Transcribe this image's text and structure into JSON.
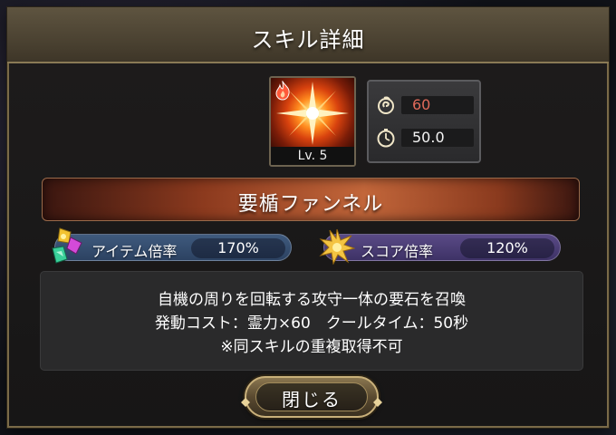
{
  "dialog": {
    "title": "スキル詳細"
  },
  "skill": {
    "level": "Lv. 5",
    "element_icon": "fire-icon",
    "name": "要楯ファンネル"
  },
  "stats": {
    "cost_icon": "spirit-swirl-icon",
    "cost": "60",
    "cost_color": "#e06a5a",
    "cooldown_icon": "stopwatch-icon",
    "cooldown": "50.0"
  },
  "multipliers": {
    "item": {
      "icon": "gems-icon",
      "label": "アイテム倍率",
      "value": "170%"
    },
    "score": {
      "icon": "star-burst-icon",
      "label": "スコア倍率",
      "value": "120%"
    }
  },
  "description": {
    "lines": [
      "自機の周りを回転する攻守一体の要石を召喚",
      "発動コスト：霊力×60　クールタイム：50秒",
      "※同スキルの重複取得不可"
    ]
  },
  "buttons": {
    "close_label": "閉じる"
  }
}
